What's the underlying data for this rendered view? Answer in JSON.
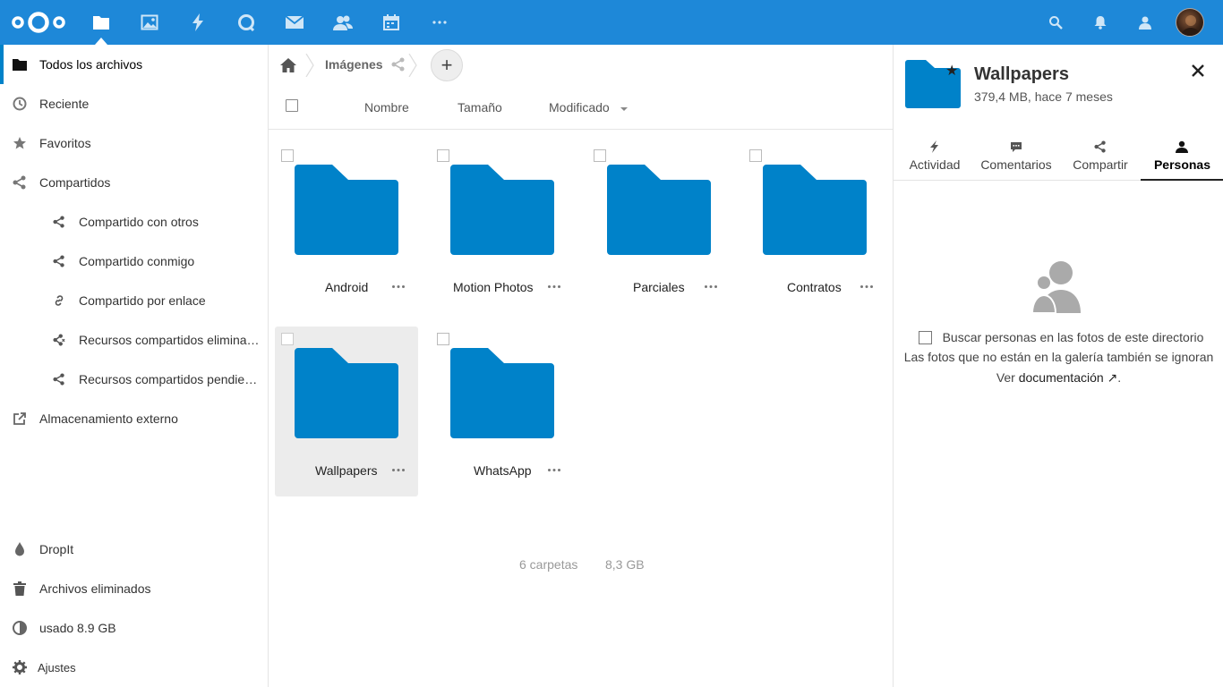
{
  "header": {
    "apps": [
      {
        "name": "files-icon"
      },
      {
        "name": "gallery-icon"
      },
      {
        "name": "activity-icon"
      },
      {
        "name": "talk-icon"
      },
      {
        "name": "mail-icon"
      },
      {
        "name": "contacts-icon"
      },
      {
        "name": "calendar-icon"
      },
      {
        "name": "more-apps-icon"
      }
    ],
    "brand_color": "#1e88d8"
  },
  "sidebar": {
    "items": [
      {
        "label": "Todos los archivos",
        "icon": "folder-icon"
      },
      {
        "label": "Reciente",
        "icon": "clock-icon"
      },
      {
        "label": "Favoritos",
        "icon": "star-icon"
      },
      {
        "label": "Compartidos",
        "icon": "share-icon"
      },
      {
        "label": "Compartido con otros",
        "icon": "share-icon"
      },
      {
        "label": "Compartido conmigo",
        "icon": "share-icon"
      },
      {
        "label": "Compartido por enlace",
        "icon": "link-icon"
      },
      {
        "label": "Recursos compartidos elimina…",
        "icon": "share-deleted-icon"
      },
      {
        "label": "Recursos compartidos pendie…",
        "icon": "share-icon"
      },
      {
        "label": "Almacenamiento externo",
        "icon": "external-icon"
      }
    ],
    "bottom": [
      {
        "label": "DropIt",
        "icon": "drop-icon"
      },
      {
        "label": "Archivos eliminados",
        "icon": "trash-icon"
      },
      {
        "label": "usado 8.9 GB",
        "icon": "quota-icon"
      },
      {
        "label": "Ajustes",
        "icon": "gear-icon"
      }
    ]
  },
  "breadcrumb": {
    "folder": "Imágenes",
    "add_label": "+"
  },
  "columns": {
    "name": "Nombre",
    "size": "Tamaño",
    "modified": "Modificado"
  },
  "files": [
    {
      "name": "Android"
    },
    {
      "name": "Motion Photos"
    },
    {
      "name": "Parciales"
    },
    {
      "name": "Contratos"
    },
    {
      "name": "Wallpapers",
      "selected": true
    },
    {
      "name": "WhatsApp"
    }
  ],
  "summary": {
    "folders": "6 carpetas",
    "size": "8,3 GB"
  },
  "details": {
    "title": "Wallpapers",
    "subtitle": "379,4 MB, hace 7 meses",
    "tabs": [
      {
        "label": "Actividad",
        "icon": "activity-icon"
      },
      {
        "label": "Comentarios",
        "icon": "comment-icon"
      },
      {
        "label": "Compartir",
        "icon": "share-icon"
      },
      {
        "label": "Personas",
        "icon": "people-icon",
        "active": true
      }
    ],
    "people": {
      "checkbox_label": "Buscar personas en las fotos de este directorio",
      "note": "Las fotos que no están en la galería también se ignoran",
      "doc_prefix": "Ver ",
      "doc_link": "documentación ↗",
      "doc_suffix": "."
    }
  },
  "colors": {
    "folder": "#0082c9",
    "accent": "#0082c9"
  }
}
